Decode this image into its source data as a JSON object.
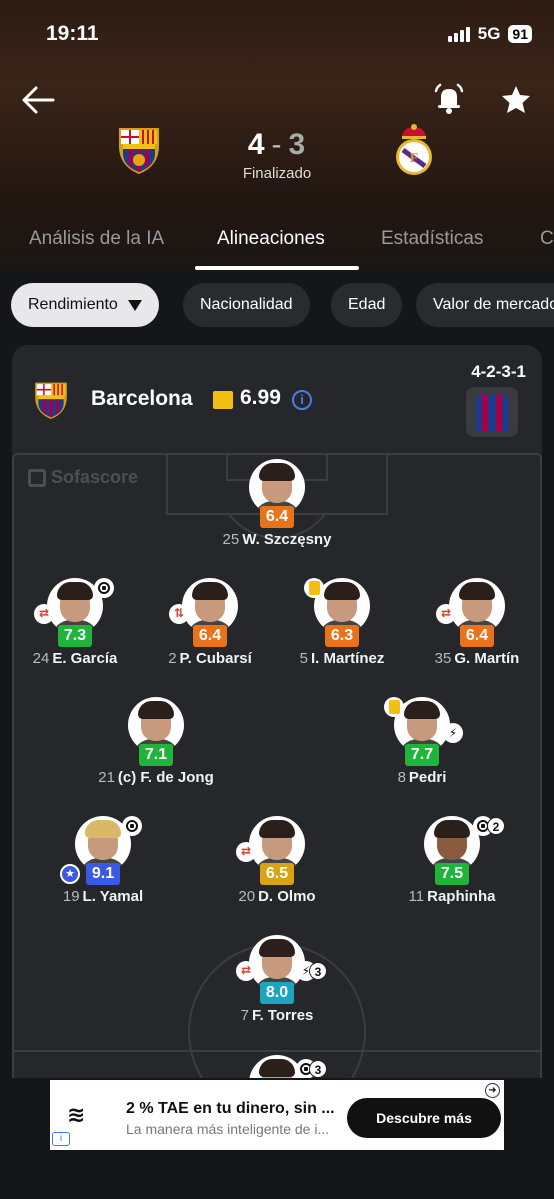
{
  "status_bar": {
    "time": "19:11",
    "network": "5G",
    "battery": "91"
  },
  "match": {
    "home_score": "4",
    "separator": "-",
    "away_score": "3",
    "status": "Finalizado"
  },
  "tabs": [
    {
      "label": "Análisis de la IA",
      "active": false
    },
    {
      "label": "Alineaciones",
      "active": true
    },
    {
      "label": "Estadísticas",
      "active": false
    },
    {
      "label": "C",
      "active": false
    }
  ],
  "filters": [
    {
      "label": "Rendimiento",
      "selected": true
    },
    {
      "label": "Nacionalidad",
      "selected": false
    },
    {
      "label": "Edad",
      "selected": false
    },
    {
      "label": "Valor de mercado",
      "selected": false
    }
  ],
  "team": {
    "name": "Barcelona",
    "rating": "6.99",
    "formation": "4-2-3-1"
  },
  "watermark": "Sofascore",
  "players": [
    {
      "number": "25",
      "name": "W. Szczęsny",
      "rating": "6.4",
      "color": "#e8731a"
    },
    {
      "number": "24",
      "name": "E. García",
      "rating": "7.3",
      "color": "#1fb53a"
    },
    {
      "number": "2",
      "name": "P. Cubarsí",
      "rating": "6.4",
      "color": "#e8731a"
    },
    {
      "number": "5",
      "name": "I. Martínez",
      "rating": "6.3",
      "color": "#e8731a"
    },
    {
      "number": "35",
      "name": "G. Martín",
      "rating": "6.4",
      "color": "#e8731a"
    },
    {
      "number": "21",
      "name": "(c) F. de Jong",
      "rating": "7.1",
      "color": "#1fb53a"
    },
    {
      "number": "8",
      "name": "Pedri",
      "rating": "7.7",
      "color": "#1fb53a"
    },
    {
      "number": "19",
      "name": "L. Yamal",
      "rating": "9.1",
      "color": "#3b59e5"
    },
    {
      "number": "20",
      "name": "D. Olmo",
      "rating": "6.5",
      "color": "#d9a412"
    },
    {
      "number": "11",
      "name": "Raphinha",
      "rating": "7.5",
      "color": "#1fb53a"
    },
    {
      "number": "7",
      "name": "F. Torres",
      "rating": "8.0",
      "color": "#1aa6c2"
    }
  ],
  "event_counts": {
    "raphinha_goals": "2",
    "torres_assists": "3",
    "extra": "3"
  },
  "ad": {
    "title": "2 % TAE en tu dinero, sin ...",
    "subtitle": "La manera más inteligente de i...",
    "cta": "Descubre más"
  }
}
